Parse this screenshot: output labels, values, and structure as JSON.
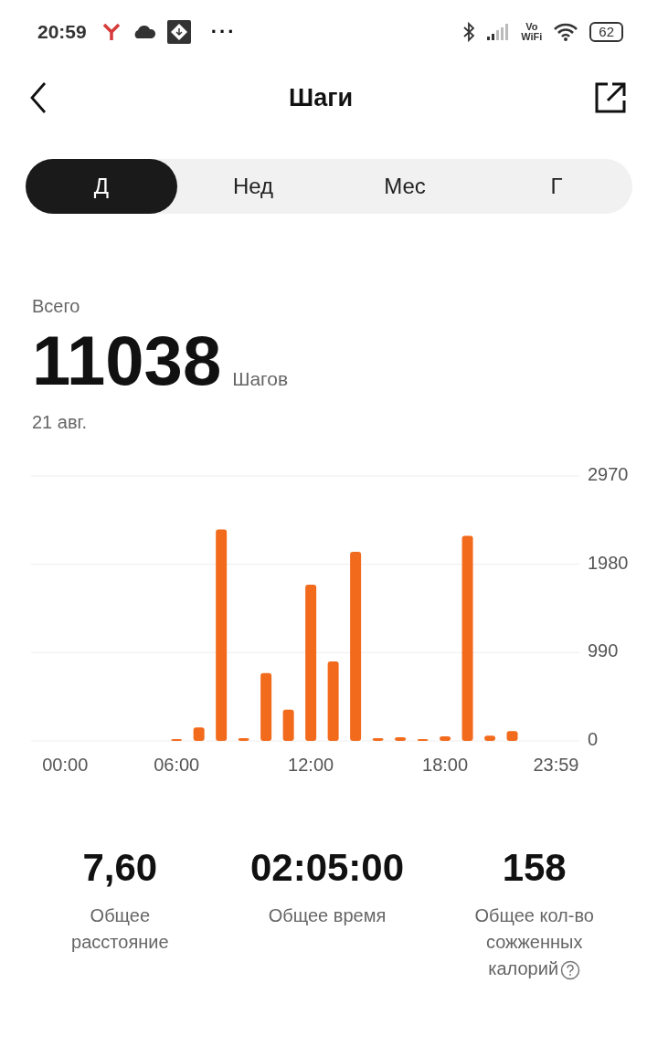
{
  "status_bar": {
    "time": "20:59",
    "battery": "62",
    "network_label_top": "Vo",
    "network_label_bottom": "WiFi",
    "more": "···"
  },
  "header": {
    "title": "Шаги"
  },
  "tabs": [
    {
      "label": "Д",
      "selected": true
    },
    {
      "label": "Нед",
      "selected": false
    },
    {
      "label": "Мес",
      "selected": false
    },
    {
      "label": "Г",
      "selected": false
    }
  ],
  "summary": {
    "label": "Всего",
    "value": "11038",
    "unit": "Шагов",
    "date": "21 авг."
  },
  "chart": {
    "chart_data": {
      "type": "bar",
      "x": [
        0,
        1,
        2,
        3,
        4,
        5,
        6,
        7,
        8,
        9,
        10,
        11,
        12,
        13,
        14,
        15,
        16,
        17,
        18,
        19,
        20,
        21,
        22,
        23
      ],
      "series": [
        {
          "color": "#f26b1d",
          "values": [
            0,
            0,
            0,
            0,
            0,
            0,
            20,
            150,
            2370,
            30,
            760,
            350,
            1750,
            890,
            2120,
            30,
            40,
            20,
            50,
            2300,
            60,
            110,
            0,
            0
          ]
        }
      ],
      "xlim": [
        -0.5,
        24
      ],
      "ylim": [
        0,
        2970
      ],
      "yticks": [
        0,
        990,
        1980,
        2970
      ],
      "xticks": [
        {
          "value": 0,
          "label": "00:00"
        },
        {
          "value": 6,
          "label": "06:00"
        },
        {
          "value": 12,
          "label": "12:00"
        },
        {
          "value": 18,
          "label": "18:00"
        },
        {
          "value": 23.98,
          "label": "23:59"
        }
      ]
    }
  },
  "stats": [
    {
      "value": "7,60",
      "label": "Общее расстояние",
      "help": false
    },
    {
      "value": "02:05:00",
      "label": "Общее время",
      "help": false
    },
    {
      "value": "158",
      "label": "Общее кол-во сожженных калорий",
      "help": true
    }
  ]
}
